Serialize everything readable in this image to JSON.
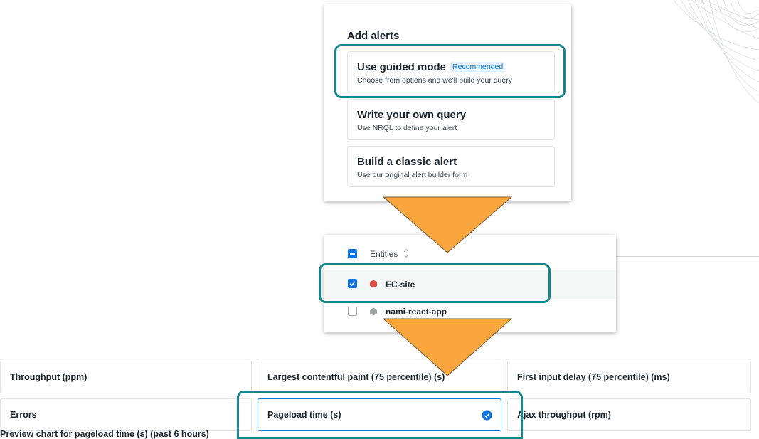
{
  "add_alerts": {
    "title": "Add alerts",
    "options": [
      {
        "title": "Use guided mode",
        "badge": "Recommended",
        "description": "Choose from options and we'll build your query"
      },
      {
        "title": "Write your own query",
        "description": "Use NRQL to define your alert"
      },
      {
        "title": "Build a classic alert",
        "description": "Use our original alert builder form"
      }
    ]
  },
  "entities": {
    "header": "Entities",
    "sort_icon": "sort-updown-icon",
    "rows": [
      {
        "name": "EC-site",
        "checked": true,
        "color": "#df4e42"
      },
      {
        "name": "nami-react-app",
        "checked": false,
        "color": "#9ea5a9"
      }
    ]
  },
  "metrics": {
    "cards": [
      {
        "label": "Throughput (ppm)"
      },
      {
        "label": "Largest contentful paint (75 percentile) (s)"
      },
      {
        "label": "First input delay (75 percentile) (ms)"
      },
      {
        "label": "Errors"
      },
      {
        "label": "Pageload time (s)",
        "selected": true
      },
      {
        "label": "Ajax throughput (rpm)"
      }
    ],
    "preview": "Preview chart for pageload time (s) (past 6 hours)"
  },
  "colors": {
    "highlight": "#13878d",
    "arrow": "#f9a63e",
    "accent": "#0c74df"
  }
}
